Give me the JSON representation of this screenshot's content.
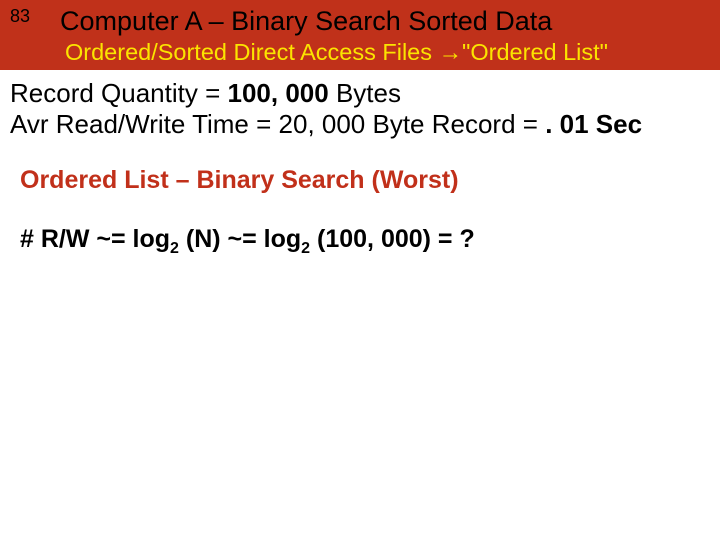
{
  "header": {
    "slide_number": "83",
    "title": "Computer A – Binary Search Sorted Data",
    "subtitle_pre": "Ordered/Sorted Direct Access Files ",
    "subtitle_arrow": "→",
    "subtitle_post": "\"Ordered List\""
  },
  "body": {
    "line1_label": "Record  Quantity =  ",
    "line1_value": "100, 000",
    "line1_unit": " Bytes",
    "line2_label": "Avr Read/Write Time = 20, 000 Byte Record = ",
    "line2_value": ". 01 Sec",
    "section_title": "Ordered List – Binary Search (Worst)",
    "formula_pre": "#  R/W  ~= log",
    "formula_sub1": "2",
    "formula_mid1": " (N) ~= log",
    "formula_sub2": "2",
    "formula_mid2": " (100, 000) = ?"
  }
}
